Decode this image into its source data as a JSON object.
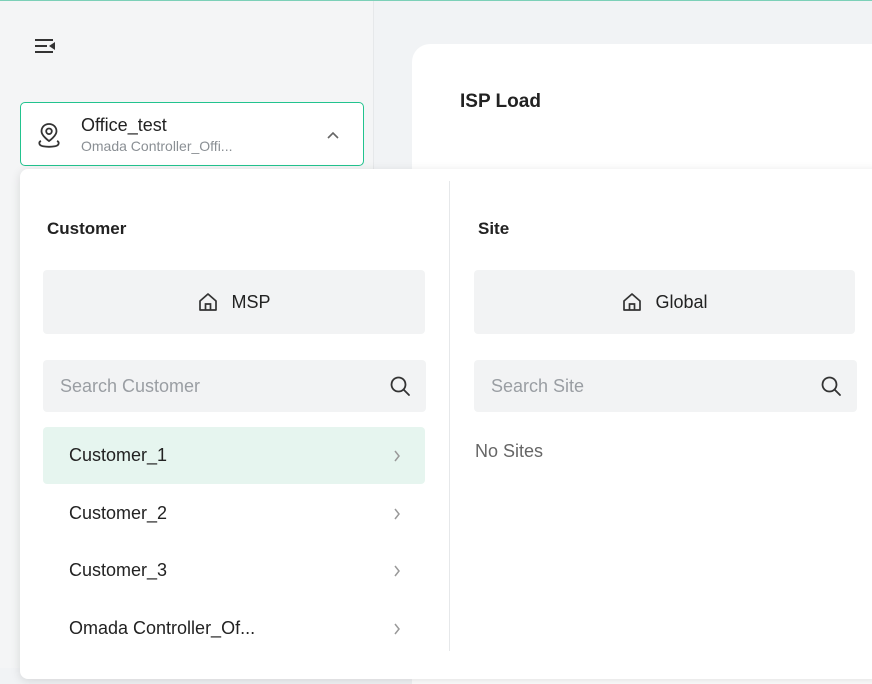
{
  "header": {
    "menu_icon": "collapse-menu-icon"
  },
  "site_selector": {
    "name": "Office_test",
    "subtitle": "Omada Controller_Offi...",
    "icon": "location-pin-icon",
    "chevron": "chevron-up-icon"
  },
  "main": {
    "title": "ISP Load"
  },
  "colors": {
    "accent": "#22c38e",
    "active_bg": "#e6f5ef"
  },
  "dropdown": {
    "customer": {
      "title": "Customer",
      "button_label": "MSP",
      "button_icon": "home-icon",
      "search_placeholder": "Search Customer",
      "search_icon": "search-icon",
      "items": [
        {
          "label": "Customer_1",
          "active": true
        },
        {
          "label": "Customer_2",
          "active": false
        },
        {
          "label": "Customer_3",
          "active": false
        },
        {
          "label": "Omada Controller_Of...",
          "active": false
        }
      ]
    },
    "site": {
      "title": "Site",
      "button_label": "Global",
      "button_icon": "home-icon",
      "search_placeholder": "Search Site",
      "search_icon": "search-icon",
      "empty_text": "No Sites"
    }
  }
}
